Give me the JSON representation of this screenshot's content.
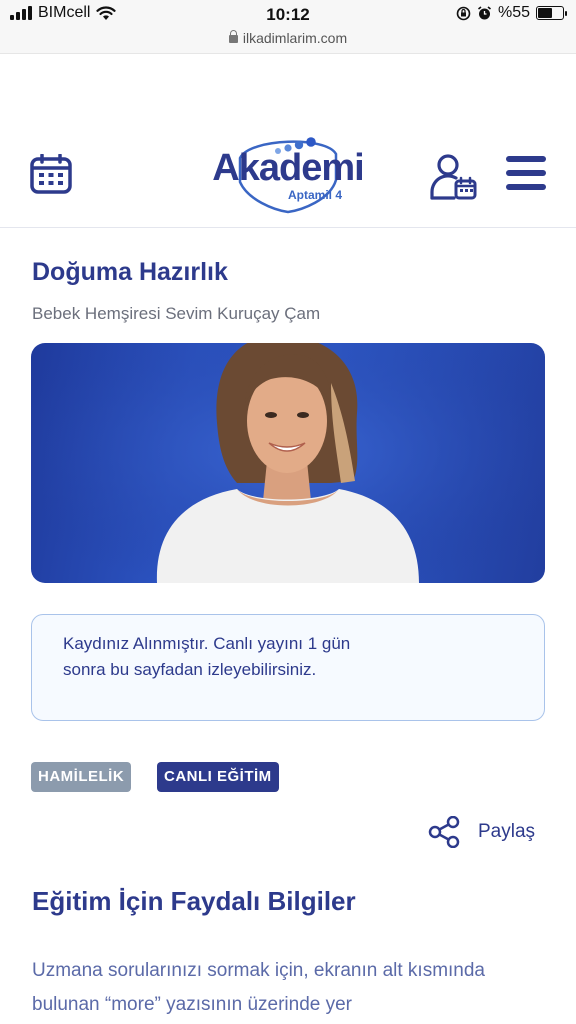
{
  "status_bar": {
    "carrier": "BIMcell",
    "time": "10:12",
    "battery_text": "%55",
    "battery_level": 0.55
  },
  "url_bar": {
    "url": "ilkadimlarim.com"
  },
  "header": {
    "logo_text": "Akademi",
    "logo_sub": "Aptamil 4",
    "icons": [
      "calendar-icon",
      "user-calendar-icon",
      "hamburger-menu-icon"
    ]
  },
  "page": {
    "title": "Doğuma Hazırlık",
    "subtitle": "Bebek Hemşiresi Sevim Kuruçay Çam",
    "notice_text": "Kaydınız Alınmıştır. Canlı yayını 1 gün sonra bu sayfadan izleyebilirsiniz.",
    "tags": [
      "HAMİLELİK",
      "CANLI EĞİTİM"
    ],
    "share_label": "Paylaş",
    "section_title": "Eğitim İçin Faydalı Bilgiler",
    "body_text": "Uzmana sorularınızı sormak için, ekranın alt kısmında bulunan “more” yazısının üzerinde yer"
  },
  "colors": {
    "brand_navy": "#2d3a8c",
    "tag_gray": "#8c9bad",
    "hero_blue": "#2b52bf",
    "notice_border": "#a9c3ea"
  }
}
